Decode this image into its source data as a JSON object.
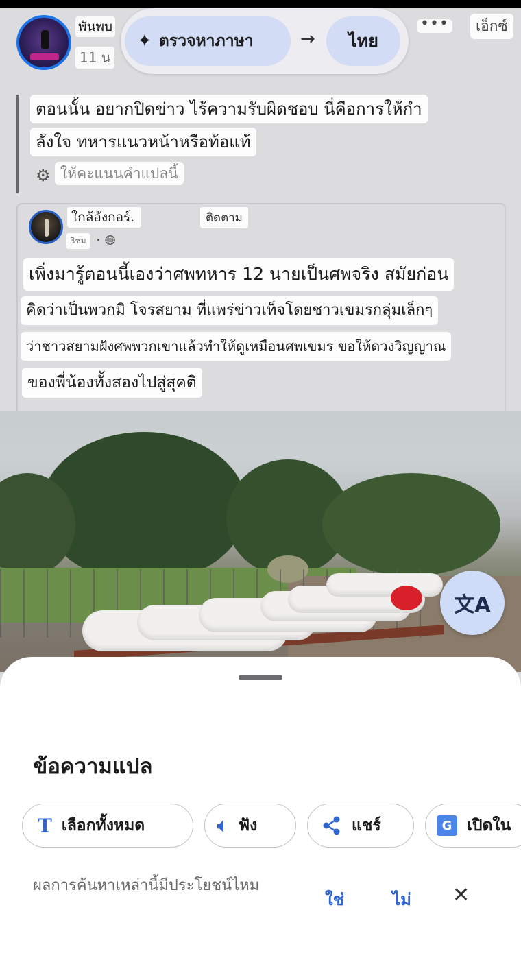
{
  "post": {
    "author": "พันพบ",
    "time": "11 น",
    "more_label": "•••",
    "close_label": "เอ็กซ์",
    "translated_lines": [
      "ตอนนั้น อยากปิดข่าว ไร้ความรับผิดชอบ นี่คือการให้กำ",
      "ลังใจ ทหารแนวหน้าหรือท้อแท้"
    ],
    "rate_label": "ให้คะแนนคำแปลนี้"
  },
  "translate_bar": {
    "detect_label": "ตรวจหาภาษา",
    "arrow": "→",
    "target_label": "ไทย"
  },
  "shared_post": {
    "author": "ใกล้อังกอร์.",
    "follow_label": "ติดตาม",
    "time": "3ชม",
    "lines": [
      "เพิ่งมารู้ตอนนี้เองว่าศพทหาร 12 นายเป็นศพจริง สมัยก่อน",
      "คิดว่าเป็นพวกมิ โจรสยาม ที่แพร่ข่าวเท็จโดยชาวเขมรกลุ่มเล็กๆ",
      "ว่าชาวสยามฝังศพพวกเขาแล้วทำให้ดูเหมือนศพเขมร ขอให้ดวงวิญญาณ",
      "ของพี่น้องทั้งสองไปสู่สุคติ"
    ]
  },
  "sheet": {
    "title": "ข้อความแปล",
    "chips": [
      {
        "icon": "text-icon",
        "label": "เลือกทั้งหมด"
      },
      {
        "icon": "speaker-icon",
        "label": "ฟัง"
      },
      {
        "icon": "share-icon",
        "label": "แชร์"
      },
      {
        "icon": "google-translate-icon",
        "label": "เปิดใน"
      }
    ],
    "feedback_question": "ผลการค้นหาเหล่านี้มีประโยชน์ไหม",
    "feedback_yes": "ใช่",
    "feedback_no": "ไม่"
  },
  "colors": {
    "accent": "#2f66d0",
    "pill": "#d2dcf4",
    "background": "#dcdcde"
  }
}
